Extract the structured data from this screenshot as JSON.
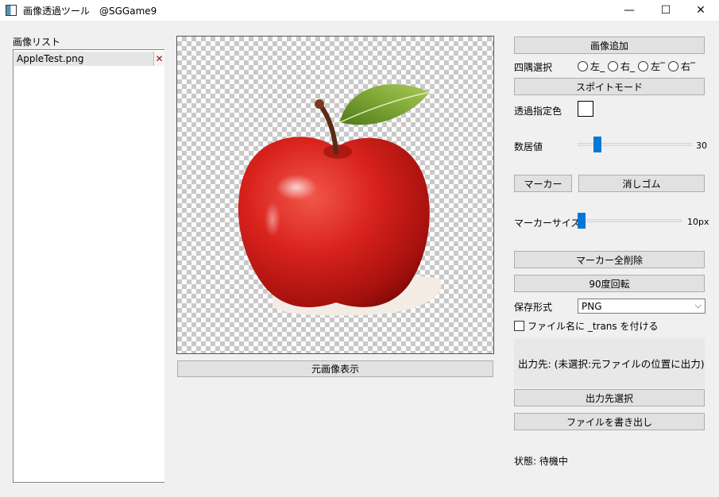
{
  "window": {
    "title": "画像透過ツール　@SGGame9",
    "minimize": "—",
    "maximize": "☐",
    "close": "✕"
  },
  "image_list": {
    "label": "画像リスト",
    "items": [
      {
        "name": "AppleTest.png",
        "remove": "✕"
      }
    ]
  },
  "canvas": {
    "show_original_label": "元画像表示"
  },
  "controls": {
    "add_image": "画像追加",
    "corner_select_label": "四隅選択",
    "corners": [
      "左_",
      "右_",
      "左‾",
      "右‾"
    ],
    "eyedropper_mode": "スポイトモード",
    "transparent_color_label": "透過指定色",
    "transparent_color": "#ffffff",
    "threshold_label": "数居値",
    "threshold_value": "30",
    "threshold_fraction": 0.15,
    "marker": "マーカー",
    "eraser": "消しゴム",
    "marker_size_label": "マーカーサイズ",
    "marker_size_value": "10px",
    "marker_size_fraction": 0.0,
    "clear_markers": "マーカー全削除",
    "rotate_90": "90度回転",
    "save_format_label": "保存形式",
    "save_format_value": "PNG",
    "save_format_arrow": "⌵",
    "append_trans_label": "ファイル名に _trans を付ける",
    "output_dest": "出力先: (未選択:元ファイルの位置に出力)",
    "select_output": "出力先選択",
    "export": "ファイルを書き出し",
    "status": "状態: 待機中"
  },
  "colors": {
    "accent": "#0078d7",
    "button_bg": "#e1e1e1",
    "apple_red": "#d8221c",
    "leaf_green": "#6f9a2e",
    "remove_x": "#c00000"
  }
}
